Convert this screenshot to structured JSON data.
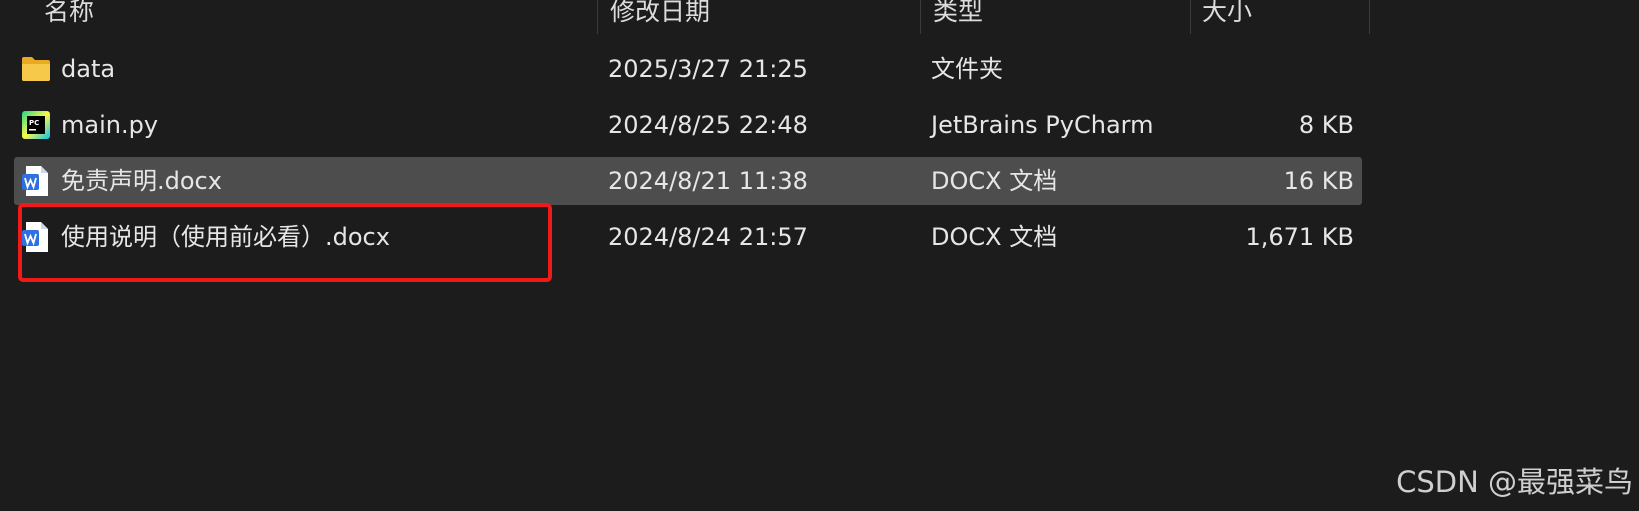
{
  "columns": {
    "name": "名称",
    "modified": "修改日期",
    "type": "类型",
    "size": "大小"
  },
  "files": [
    {
      "name": "data",
      "modified": "2025/3/27 21:25",
      "type": "文件夹",
      "size": "",
      "icon": "folder-icon"
    },
    {
      "name": "main.py",
      "modified": "2024/8/25 22:48",
      "type": "JetBrains PyCharm",
      "size": "8 KB",
      "icon": "pycharm-icon"
    },
    {
      "name": "免责声明.docx",
      "modified": "2024/8/21 11:38",
      "type": "DOCX 文档",
      "size": "16 KB",
      "icon": "wps-word-icon",
      "selected": true
    },
    {
      "name": "使用说明（使用前必看）.docx",
      "modified": "2024/8/24 21:57",
      "type": "DOCX 文档",
      "size": "1,671 KB",
      "icon": "wps-word-icon",
      "highlighted": true
    }
  ],
  "colors": {
    "background": "#1c1c1c",
    "selected_row": "#4d4d4d",
    "highlight_border": "#f01a1a",
    "folder": "#f5c242",
    "wps_blue": "#2f6fe0"
  },
  "watermark": "CSDN @最强菜鸟"
}
